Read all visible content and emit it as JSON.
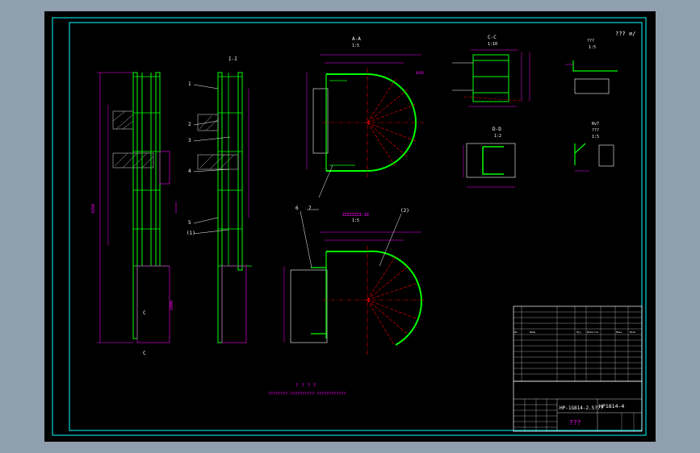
{
  "colors": {
    "viewport_bg": "#8f9fae",
    "sheet_bg": "#000000",
    "frame": "#00ffff",
    "steel": "#00ff00",
    "dim": "#ff00ff",
    "center": "#ff0000",
    "hatch": "#c0c0c0",
    "note": "#ffff00",
    "table_line": "#ffffff"
  },
  "corner_note": "??? ⌀/",
  "views": {
    "elevation_main": {
      "title": "",
      "dim_total": "4250",
      "dim_lower": "1000",
      "label_c": "C",
      "label_c2": "C"
    },
    "elevation_side": {
      "title": "I-I",
      "callouts": [
        "1",
        "2",
        "3",
        "4",
        "5",
        "(1)"
      ]
    },
    "plan_upper": {
      "title": "A-A",
      "scale": "1:5",
      "callout": "7",
      "dim_radius": "R450"
    },
    "plan_lower": {
      "title": "ΣΣΣΣΣΣΣΣ-ΣΣ",
      "scale": "1:5",
      "callouts": [
        "6",
        "(2)"
      ]
    },
    "section_cc": {
      "title": "C-C",
      "scale": "1:10"
    },
    "section_dd": {
      "title": "D-D",
      "scale": "1:2"
    },
    "detail_1": {
      "title": "???",
      "scale": "1:5"
    },
    "detail_2": {
      "title": "Rv7",
      "subtitle": "???",
      "scale": "1:5"
    }
  },
  "notes": {
    "title": "? ? ? ?",
    "body": "????????-??????????-????????????"
  },
  "table": {
    "header": [
      "No.",
      "Name",
      "Qty",
      "Material",
      "Mass",
      "Note"
    ],
    "drawing_no": "HP1814-4",
    "drawing_name": "HP-1G814-2.5???",
    "company": "???"
  }
}
